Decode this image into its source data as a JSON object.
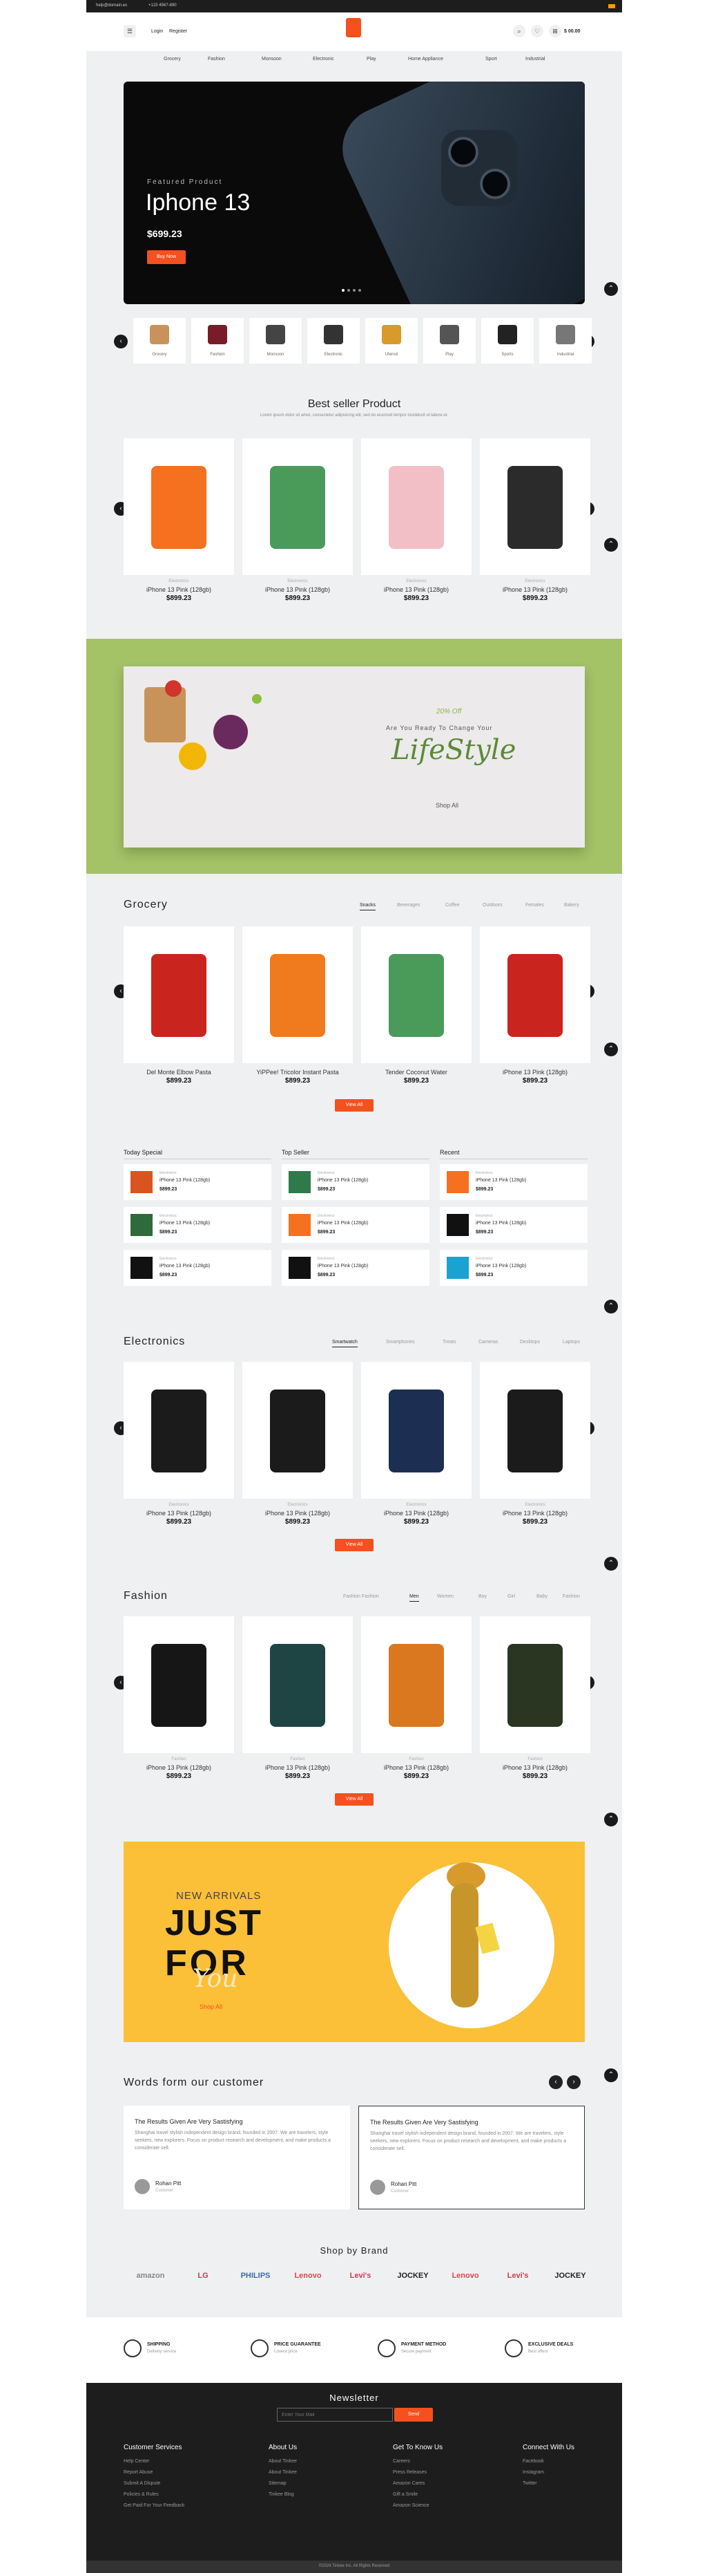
{
  "topbar": {
    "email": "help@domain.ex",
    "phone": "+123 4567-890"
  },
  "header": {
    "login": "Login",
    "register": "Register",
    "cart_total": "$ 00.00",
    "cart_count": "0",
    "wish_count": "0"
  },
  "nav": [
    "Grocery",
    "Fashion",
    "Monsoon",
    "Electronic",
    "Play",
    "Home Appliance",
    "Sport",
    "Industrial"
  ],
  "hero": {
    "label": "Featured Product",
    "title": "Iphone 13",
    "price": "$699.23",
    "button": "Buy Now"
  },
  "categories": [
    "Grocery",
    "Fashion",
    "Monsoon",
    "Electronic",
    "Utensil",
    "Play",
    "Sports",
    "Industrial"
  ],
  "bestseller": {
    "title": "Best seller Product",
    "subtitle": "Lorem ipsum dolor sit amet, consectetur adipisicing elit, sed do eiusmod tempor incididunt ut labore et.",
    "products": [
      {
        "cat": "Electronics",
        "name": "iPhone 13 Pink (128gb)",
        "price": "$899.23"
      },
      {
        "cat": "Electronics",
        "name": "iPhone 13 Pink (128gb)",
        "price": "$899.23"
      },
      {
        "cat": "Electronics",
        "name": "iPhone 13 Pink (128gb)",
        "price": "$899.23"
      },
      {
        "cat": "Electronics",
        "name": "iPhone 13 Pink (128gb)",
        "price": "$899.23"
      }
    ]
  },
  "lifestyle": {
    "off": "20% Off",
    "line": "Are You Ready To Change Your",
    "title": "LifeStyle",
    "cta": "Shop All"
  },
  "grocery": {
    "title": "Grocery",
    "tabs": [
      "Snacks",
      "Beverages",
      "Coffee",
      "Outdoors",
      "Females",
      "Bakery"
    ],
    "products": [
      {
        "name": "Del Monte Elbow Pasta",
        "price": "$899.23"
      },
      {
        "name": "YiPPee! Tricolor Instant Pasta",
        "price": "$899.23"
      },
      {
        "name": "Tender Coconut Water",
        "price": "$899.23"
      },
      {
        "name": "iPhone 13 Pink (128gb)",
        "price": "$899.23"
      }
    ],
    "view": "View All"
  },
  "lists": {
    "cols": [
      {
        "title": "Today Special"
      },
      {
        "title": "Top Seller"
      },
      {
        "title": "Recent"
      }
    ],
    "cat": "Electronics",
    "name": "iPhone 13 Pink (128gb)",
    "price": "$899.23"
  },
  "electronics": {
    "title": "Electronics",
    "tabs": [
      "Smartwatch",
      "Smartphones",
      "Treats",
      "Cameras",
      "Desktops",
      "Laptops"
    ],
    "products": [
      {
        "cat": "Electronics",
        "name": "iPhone 13 Pink (128gb)",
        "price": "$899.23"
      },
      {
        "cat": "Electronics",
        "name": "iPhone 13 Pink (128gb)",
        "price": "$899.23"
      },
      {
        "cat": "Electronics",
        "name": "iPhone 13 Pink (128gb)",
        "price": "$899.23"
      },
      {
        "cat": "Electronics",
        "name": "iPhone 13 Pink (128gb)",
        "price": "$899.23"
      }
    ],
    "view": "View All"
  },
  "fashion": {
    "title": "Fashion",
    "tabs": [
      "Fashion Fashion",
      "Men",
      "Women",
      "Boy",
      "Girl",
      "Baby",
      "Fashion"
    ],
    "products": [
      {
        "cat": "Fashion",
        "name": "iPhone 13 Pink (128gb)",
        "price": "$899.23"
      },
      {
        "cat": "Fashion",
        "name": "iPhone 13 Pink (128gb)",
        "price": "$899.23"
      },
      {
        "cat": "Fashion",
        "name": "iPhone 13 Pink (128gb)",
        "price": "$899.23"
      },
      {
        "cat": "Fashion",
        "name": "iPhone 13 Pink (128gb)",
        "price": "$899.23"
      }
    ],
    "view": "View All"
  },
  "arrivals": {
    "small": "NEW ARRIVALS",
    "big1": "JUST",
    "big2": "FOR",
    "script": "You",
    "cta": "Shop All"
  },
  "testimonials": {
    "title": "Words form our customer",
    "items": [
      {
        "head": "The Results Given Are Very Sastisfying",
        "text": "Shanghai travel stylish independent design brand, founded in 2007. We are travelers, style seekers, new explorers. Focus on product research and development, and make products a considerate sell.",
        "name": "Rohan Pitt",
        "role": "Customer"
      },
      {
        "head": "The Results Given Are Very Sastisfying",
        "text": "Shanghai travel stylish independent design brand, founded in 2007. We are travelers, style seekers, new explorers. Focus on product research and development, and make products a considerate sell.",
        "name": "Rohan Pitt",
        "role": "Customer"
      }
    ]
  },
  "brands": {
    "title": "Shop by Brand",
    "items": [
      "amazon",
      "LG",
      "PHILIPS",
      "Lenovo",
      "Levi's",
      "JOCKEY",
      "Lenovo",
      "Levi's",
      "JOCKEY"
    ]
  },
  "features": [
    {
      "t": "SHIPPING",
      "s": "Delivery service"
    },
    {
      "t": "PRICE GUARANTEE",
      "s": "Lowest price"
    },
    {
      "t": "PAYMENT METHOD",
      "s": "Secure payment"
    },
    {
      "t": "EXCLUSIVE DEALS",
      "s": "Best offers"
    }
  ],
  "footer": {
    "newsletter": "Newsletter",
    "placeholder": "Enter Your Mail",
    "send": "Send",
    "cols": [
      {
        "h": "Customer Services",
        "items": [
          "Help Center",
          "Report Abuse",
          "Submit A Dispute",
          "Policies & Rules",
          "Get Paid For Your Feedback"
        ]
      },
      {
        "h": "About Us",
        "items": [
          "About Tinkee",
          "About Tinkee",
          "Sitemap",
          "Tinkee Blog"
        ]
      },
      {
        "h": "Get To Know Us",
        "items": [
          "Careers",
          "Press Releases",
          "Amazon Cares",
          "Gift a Smile",
          "Amazon Science"
        ]
      },
      {
        "h": "Connect With Us",
        "items": [
          "Facebook",
          "Instagram",
          "Twitter"
        ]
      }
    ],
    "copyright": "©2024 Tinkee Inc. All Rights Reserved"
  }
}
